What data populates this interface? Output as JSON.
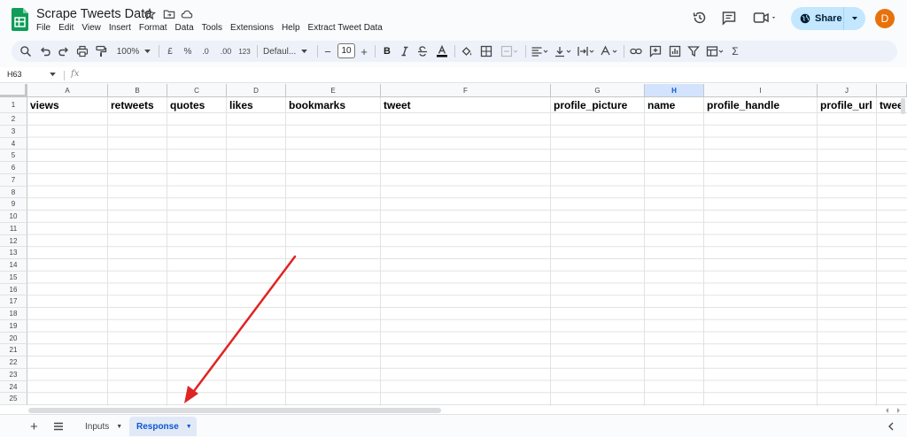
{
  "app": {
    "title": "Scrape Tweets Data",
    "user_initial": "D",
    "share_label": "Share"
  },
  "menu": [
    "File",
    "Edit",
    "View",
    "Insert",
    "Format",
    "Data",
    "Tools",
    "Extensions",
    "Help",
    "Extract Tweet Data"
  ],
  "toolbar": {
    "zoom": "100%",
    "currency": "£",
    "percent": "%",
    "decrease_decimal": ".0",
    "increase_decimal": ".00",
    "number_format": "123",
    "font": "Defaul...",
    "font_size": "10",
    "bold": "B"
  },
  "formula_bar": {
    "name_box": "H63",
    "fx": "fx"
  },
  "grid": {
    "columns": [
      "A",
      "B",
      "C",
      "D",
      "E",
      "F",
      "G",
      "H",
      "I",
      "J"
    ],
    "selected_column": "H",
    "header_row": [
      "views",
      "retweets",
      "quotes",
      "likes",
      "bookmarks",
      "tweet",
      "profile_picture",
      "name",
      "profile_handle",
      "profile_url",
      "twee"
    ],
    "rows": [
      "1",
      "2",
      "3",
      "4",
      "5",
      "6",
      "7",
      "8",
      "9",
      "10",
      "11",
      "12",
      "13",
      "14",
      "15",
      "16",
      "17",
      "18",
      "19",
      "20",
      "21",
      "22",
      "23",
      "24",
      "25"
    ]
  },
  "sheets": {
    "tabs": [
      {
        "label": "Inputs",
        "active": false
      },
      {
        "label": "Response",
        "active": true
      }
    ]
  },
  "colors": {
    "accent": "#0b57d0",
    "share_bg": "#c2e7ff",
    "avatar": "#e8710a",
    "arrow": "#e02424"
  }
}
